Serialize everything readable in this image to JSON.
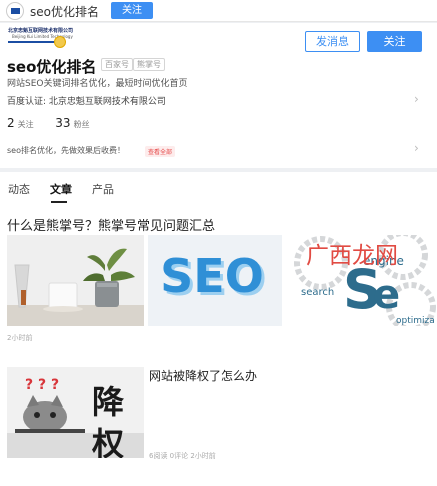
{
  "topbar": {
    "title": "seo优化排名",
    "follow_label": "关注"
  },
  "profile": {
    "logo_line1": "北京忠魁互联网技术有限公司",
    "logo_line2": "Beijing Kui Limited Technology",
    "name": "seo优化排名",
    "tags": [
      "百家号",
      "熊掌号"
    ],
    "message_label": "发消息",
    "follow_label": "关注",
    "description": "网站SEO关键词排名优化，最短时间优化首页",
    "certification": "百度认证: 北京忠魁互联网技术有限公司",
    "stats": {
      "following_count": "2",
      "following_label": "关注",
      "fans_count": "33",
      "fans_label": "粉丝"
    },
    "note": "seo排名优化，先做效果后收费！",
    "note_tag": "查看全部"
  },
  "tabs": [
    {
      "label": "动态",
      "active": false
    },
    {
      "label": "文章",
      "active": true
    },
    {
      "label": "产品",
      "active": false
    }
  ],
  "articles": [
    {
      "title": "什么是熊掌号？熊掌号常见问题汇总",
      "time": "2小时前",
      "images": [
        "plant-and-cups-photo",
        "seo-3d-text",
        "seo-gears-graphic"
      ],
      "image_texts": {
        "seo": "SEO",
        "engine": "engine",
        "search": "search",
        "optimiza": "optimiza"
      }
    },
    {
      "title": "网站被降权了怎么办",
      "image_text": [
        "降",
        "权"
      ],
      "question_marks": "? ? ?",
      "meta": "6阅读  0评论  2小时前"
    }
  ],
  "watermark": "广西龙网",
  "colors": {
    "accent": "#3d8ff3",
    "tag_red": "#e64a4a",
    "watermark": "#e14b43"
  }
}
